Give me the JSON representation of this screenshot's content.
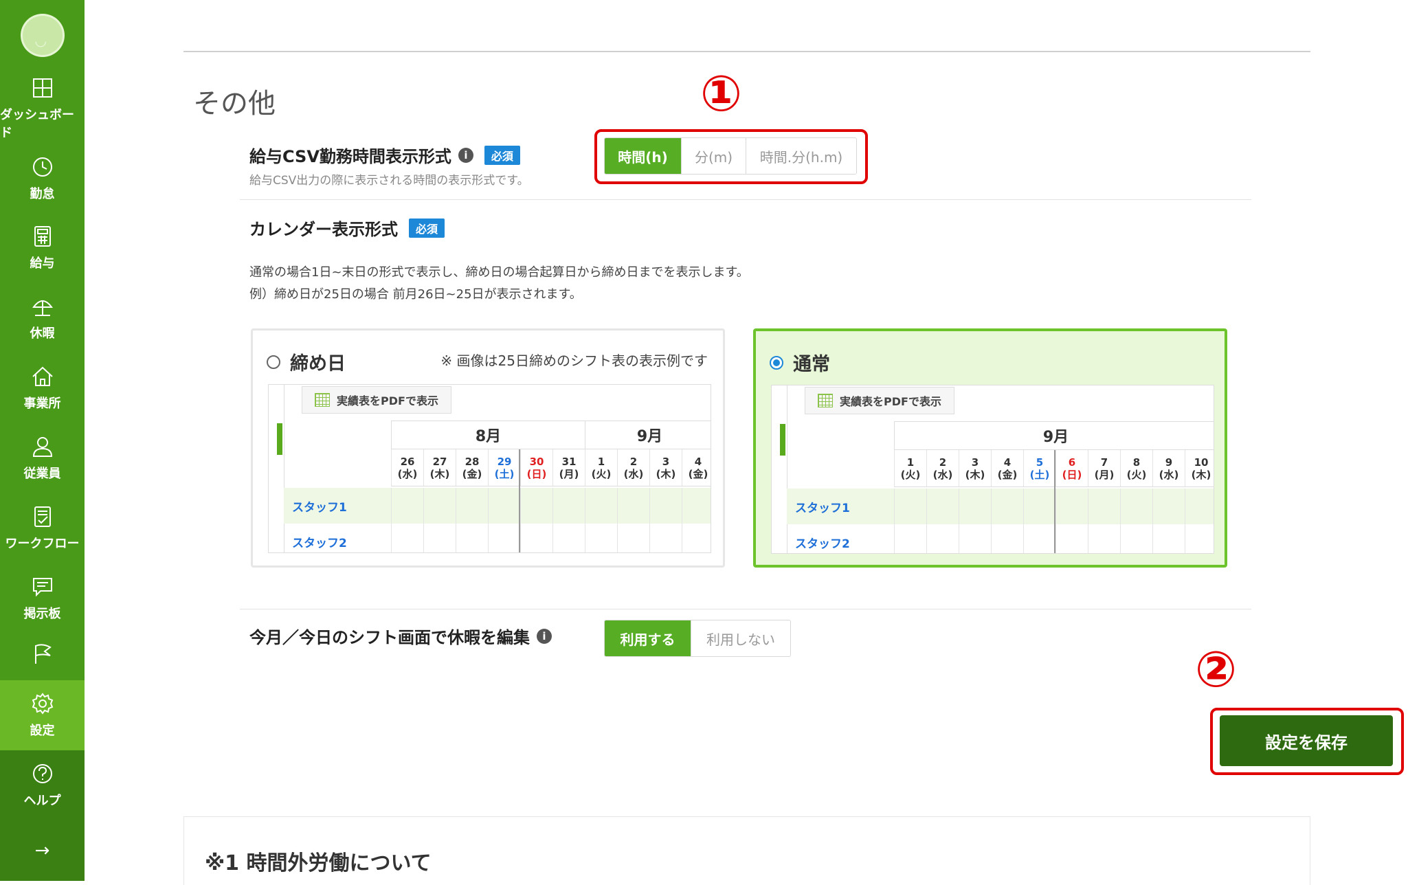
{
  "sidebar": {
    "items": [
      {
        "label": "ダッシュボード",
        "icon": "dashboard-icon"
      },
      {
        "label": "勤怠",
        "icon": "clock-icon"
      },
      {
        "label": "給与",
        "icon": "calculator-icon"
      },
      {
        "label": "休暇",
        "icon": "beach-umbrella-icon"
      },
      {
        "label": "事業所",
        "icon": "home-icon"
      },
      {
        "label": "従業員",
        "icon": "person-icon"
      },
      {
        "label": "ワークフロー",
        "icon": "checklist-icon"
      },
      {
        "label": "掲示板",
        "icon": "message-icon"
      },
      {
        "label": "",
        "icon": "flag-icon"
      },
      {
        "label": "設定",
        "icon": "gear-icon"
      },
      {
        "label": "ヘルプ",
        "icon": "help-icon"
      }
    ],
    "expand_arrow": "→"
  },
  "section": {
    "title": "その他"
  },
  "annotations": {
    "one": "①",
    "two": "②"
  },
  "csv_format": {
    "label": "給与CSV勤務時間表示形式",
    "required": "必須",
    "desc": "給与CSV出力の際に表示される時間の表示形式です。",
    "options": [
      "時間(h)",
      "分(m)",
      "時間.分(h.m)"
    ],
    "selected": "時間(h)"
  },
  "calendar_format": {
    "label": "カレンダー表示形式",
    "required": "必須",
    "desc_line1": "通常の場合1日~末日の形式で表示し、締め日の場合起算日から締め日までを表示します。",
    "desc_line2": "例）締め日が25日の場合 前月26日~25日が表示されます。",
    "option_closing": {
      "label": "締め日",
      "note": "※ 画像は25日締めのシフト表の表示例です",
      "pdf_button": "実績表をPDFで表示",
      "months": [
        "8月",
        "9月"
      ],
      "days": [
        {
          "d": "26",
          "w": "(水)",
          "t": "normal"
        },
        {
          "d": "27",
          "w": "(木)",
          "t": "normal"
        },
        {
          "d": "28",
          "w": "(金)",
          "t": "normal"
        },
        {
          "d": "29",
          "w": "(土)",
          "t": "sat"
        },
        {
          "d": "30",
          "w": "(日)",
          "t": "sun"
        },
        {
          "d": "31",
          "w": "(月)",
          "t": "normal"
        },
        {
          "d": "1",
          "w": "(火)",
          "t": "normal"
        },
        {
          "d": "2",
          "w": "(水)",
          "t": "normal"
        },
        {
          "d": "3",
          "w": "(木)",
          "t": "normal"
        },
        {
          "d": "4",
          "w": "(金)",
          "t": "normal"
        }
      ],
      "staff": [
        "スタッフ1",
        "スタッフ2"
      ]
    },
    "option_normal": {
      "label": "通常",
      "pdf_button": "実績表をPDFで表示",
      "months": [
        "9月"
      ],
      "days": [
        {
          "d": "1",
          "w": "(火)",
          "t": "normal"
        },
        {
          "d": "2",
          "w": "(水)",
          "t": "normal"
        },
        {
          "d": "3",
          "w": "(木)",
          "t": "normal"
        },
        {
          "d": "4",
          "w": "(金)",
          "t": "normal"
        },
        {
          "d": "5",
          "w": "(土)",
          "t": "sat"
        },
        {
          "d": "6",
          "w": "(日)",
          "t": "sun"
        },
        {
          "d": "7",
          "w": "(月)",
          "t": "normal"
        },
        {
          "d": "8",
          "w": "(火)",
          "t": "normal"
        },
        {
          "d": "9",
          "w": "(水)",
          "t": "normal"
        },
        {
          "d": "10",
          "w": "(木)",
          "t": "normal"
        }
      ],
      "staff": [
        "スタッフ1",
        "スタッフ2"
      ]
    },
    "selected": "通常"
  },
  "edit_leave": {
    "label": "今月／今日のシフト画面で休暇を編集",
    "options": [
      "利用する",
      "利用しない"
    ],
    "selected": "利用する"
  },
  "save_button": "設定を保存",
  "bottom_section": {
    "title": "※1 時間外労働について"
  },
  "colors": {
    "sidebar": "#4a9a1a",
    "accent": "#57ad24",
    "annotation": "#e00000",
    "badge": "#1e88d8",
    "save": "#2e6a10"
  }
}
